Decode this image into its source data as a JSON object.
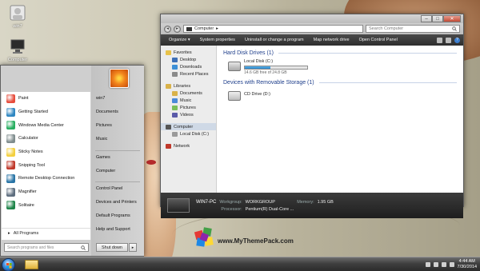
{
  "desktop": {
    "icons": [
      {
        "label": "win7"
      },
      {
        "label": "Computer"
      }
    ],
    "brand_text": "www.MyThemePack.com"
  },
  "explorer": {
    "address_parts": [
      "Computer",
      "▸"
    ],
    "search_placeholder": "Search Computer",
    "toolbar": [
      "Organize ▾",
      "System properties",
      "Uninstall or change a program",
      "Map network drive",
      "Open Control Panel"
    ],
    "nav": [
      {
        "label": "Favorites",
        "child": false,
        "color": "#e8c24a"
      },
      {
        "label": "Desktop",
        "child": true,
        "color": "#3d6fb6"
      },
      {
        "label": "Downloads",
        "child": true,
        "color": "#3d8fd6"
      },
      {
        "label": "Recent Places",
        "child": true,
        "color": "#8a8a8a"
      },
      {
        "label": "Libraries",
        "child": false,
        "color": "#d9b24a"
      },
      {
        "label": "Documents",
        "child": true,
        "color": "#d9b24a"
      },
      {
        "label": "Music",
        "child": true,
        "color": "#4a8ad9"
      },
      {
        "label": "Pictures",
        "child": true,
        "color": "#7abf5a"
      },
      {
        "label": "Videos",
        "child": true,
        "color": "#5a5aa9"
      },
      {
        "label": "Computer",
        "child": false,
        "color": "#555555",
        "selected": true
      },
      {
        "label": "Local Disk (C:)",
        "child": true,
        "color": "#9a9a9a"
      },
      {
        "label": "Network",
        "child": false,
        "color": "#c0392b"
      }
    ],
    "groups": {
      "hard_disk_title": "Hard Disk Drives (1)",
      "removable_title": "Devices with Removable Storage (1)"
    },
    "drives": {
      "local_name": "Local Disk (C:)",
      "local_free": "14.6 GB free of 24.8 GB",
      "local_used_fraction": 0.41,
      "cd_name": "CD Drive (D:)"
    },
    "details": {
      "pc_name": "WIN7-PC",
      "workgroup_key": "Workgroup:",
      "workgroup_val": "WORKGROUP",
      "memory_key": "Memory:",
      "memory_val": "1.95 GB",
      "processor_key": "Processor:",
      "processor_val": "Pentium(R) Dual-Core ..."
    },
    "window_buttons": {
      "minimize": "–",
      "maximize": "□",
      "close": "✕"
    }
  },
  "startmenu": {
    "programs": [
      {
        "label": "Paint",
        "color": "#e74c3c"
      },
      {
        "label": "Getting Started",
        "color": "#2e86c1"
      },
      {
        "label": "Windows Media Center",
        "color": "#27ae60"
      },
      {
        "label": "Calculator",
        "color": "#7f8c8d"
      },
      {
        "label": "Sticky Notes",
        "color": "#f4d03f"
      },
      {
        "label": "Snipping Tool",
        "color": "#c0392b"
      },
      {
        "label": "Remote Desktop Connection",
        "color": "#2874a6"
      },
      {
        "label": "Magnifier",
        "color": "#5d6d7e"
      },
      {
        "label": "Solitaire",
        "color": "#1e8449"
      }
    ],
    "all_programs": "All Programs",
    "search_placeholder": "Search programs and files",
    "right_links": [
      "win7",
      "Documents",
      "Pictures",
      "Music",
      "Games",
      "Computer",
      "Control Panel",
      "Devices and Printers",
      "Default Programs",
      "Help and Support"
    ],
    "shutdown": "Shut down",
    "shutdown_arrow": "▸"
  },
  "taskbar": {
    "time": "4:44 AM",
    "date": "7/30/2014"
  }
}
